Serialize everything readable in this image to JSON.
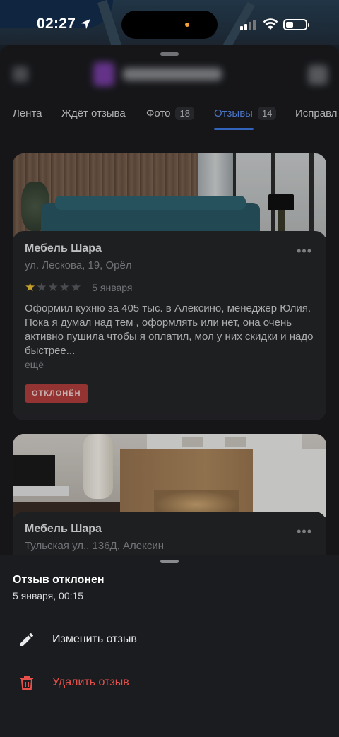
{
  "status_bar": {
    "time": "02:27"
  },
  "tabs": [
    {
      "label": "Лента",
      "count": ""
    },
    {
      "label": "Ждёт отзыва",
      "count": ""
    },
    {
      "label": "Фото",
      "count": "18"
    },
    {
      "label": "Отзывы",
      "count": "14"
    },
    {
      "label": "Исправл",
      "count": ""
    }
  ],
  "active_tab": "Отзывы",
  "cards": [
    {
      "title": "Мебель Шара",
      "address": "ул. Лескова, 19, Орёл",
      "rating": 1,
      "rating_max": 5,
      "date": "5 января",
      "text": "Оформил кухню за 405 тыс. в Алексино, менеджер Юлия. Пока я думал над тем , оформлять или нет, она очень активно пушила чтобы я оплатил, мол у них скидки и надо быстрее...",
      "more": "ещё",
      "badge": "ОТКЛОНЁН"
    },
    {
      "title": "Мебель Шара",
      "address": "Тульская ул., 136Д, Алексин"
    }
  ],
  "action_sheet": {
    "title": "Отзыв отклонен",
    "subtitle": "5 января, 00:15",
    "edit_label": "Изменить отзыв",
    "delete_label": "Удалить отзыв"
  },
  "colors": {
    "accent": "#3f7ae6",
    "rejected_badge": "#b4403d",
    "delete": "#e8514b",
    "star": "#f1c232"
  },
  "icons": {
    "location": "location-arrow-icon",
    "edit": "pencil-icon",
    "delete": "trash-icon",
    "more": "more-dots-icon"
  }
}
